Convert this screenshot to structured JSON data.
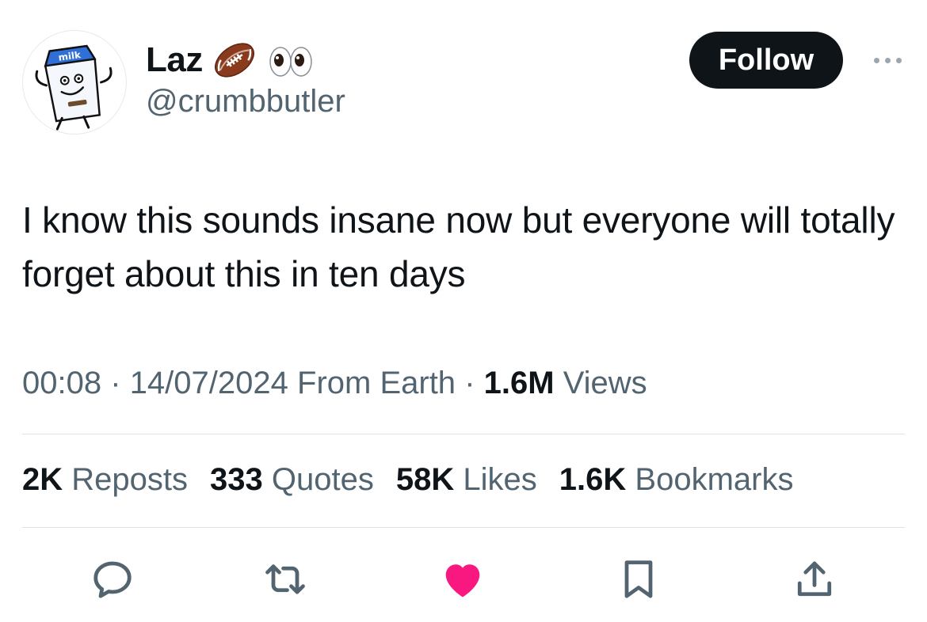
{
  "author": {
    "display_name": "Laz",
    "handle": "@crumbbutler",
    "name_emojis": [
      "football-emoji",
      "eyes-emoji"
    ],
    "avatar_text": "milk"
  },
  "follow_label": "Follow",
  "tweet": {
    "text": "I know this sounds insane now but everyone will totally forget about this in ten days"
  },
  "meta": {
    "time": "00:08",
    "separator": "·",
    "date": "14/07/2024",
    "source": "From Earth",
    "views_count": "1.6M",
    "views_label": "Views"
  },
  "stats": {
    "reposts_count": "2K",
    "reposts_label": "Reposts",
    "quotes_count": "333",
    "quotes_label": "Quotes",
    "likes_count": "58K",
    "likes_label": "Likes",
    "bookmarks_count": "1.6K",
    "bookmarks_label": "Bookmarks"
  },
  "actions": [
    "reply-icon",
    "repost-icon",
    "like-icon",
    "bookmark-icon",
    "share-icon"
  ],
  "colors": {
    "text": "#0f1419",
    "secondary": "#536471",
    "follow_bg": "#0f1419",
    "like": "#f91880",
    "divider": "#dfe3e7"
  }
}
